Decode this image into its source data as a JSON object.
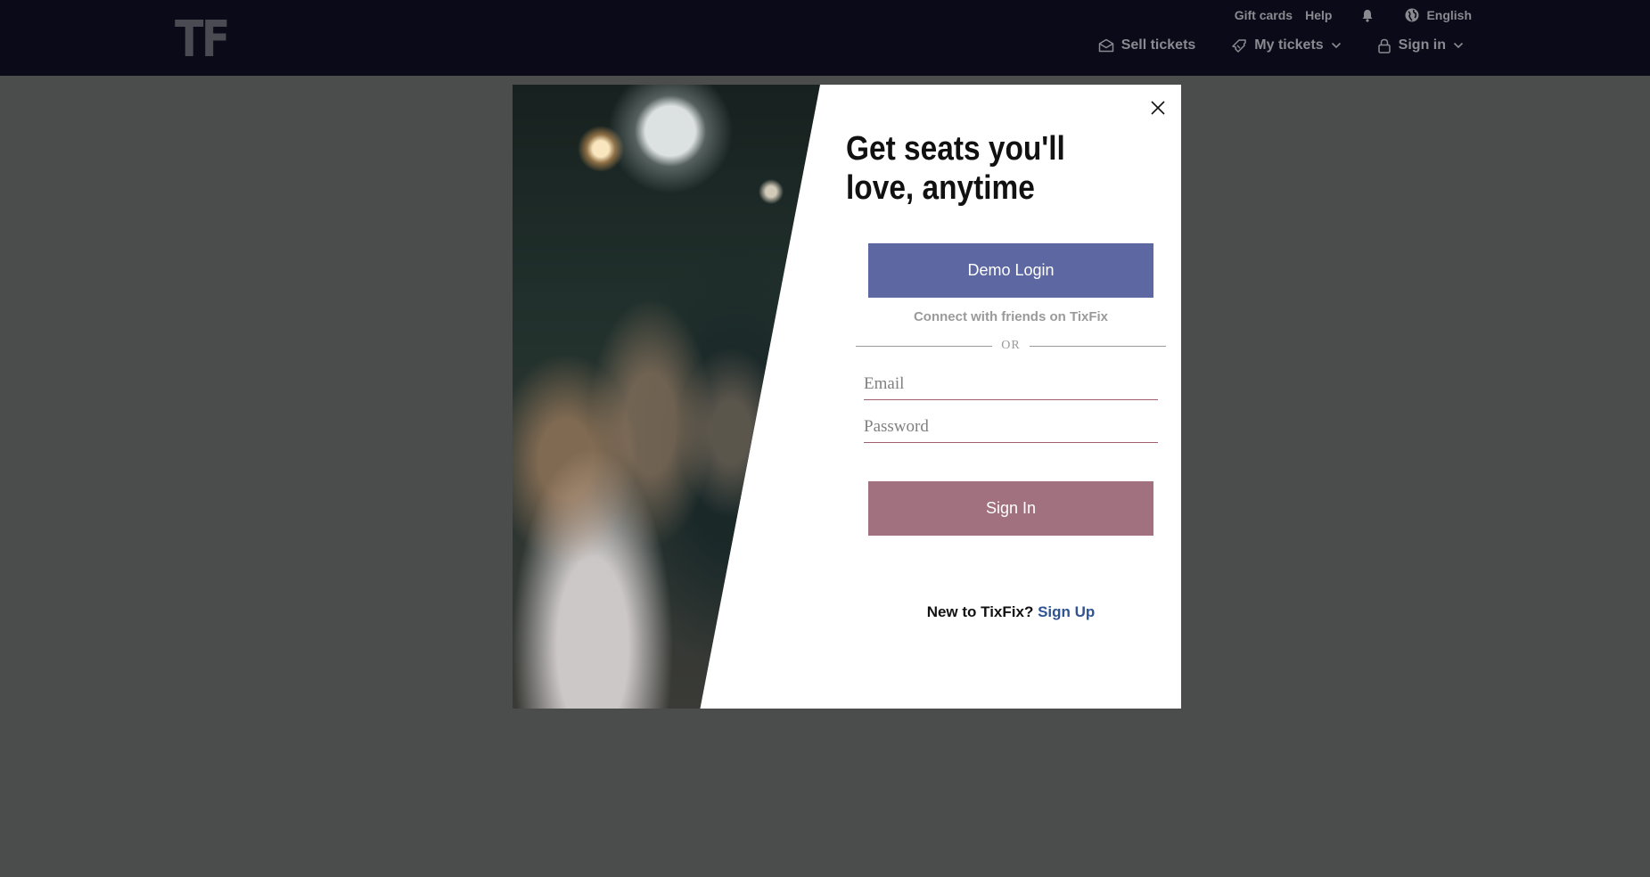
{
  "header": {
    "logo": "TF",
    "util": {
      "gift_cards": "Gift cards",
      "help": "Help",
      "language": "English"
    },
    "nav": {
      "sell_tickets": "Sell tickets",
      "my_tickets": "My tickets",
      "sign_in": "Sign in"
    }
  },
  "modal": {
    "title": "Get seats you'll love, anytime",
    "demo_login": "Demo Login",
    "connect_text": "Connect with friends on TixFix",
    "or_text": "OR",
    "email_placeholder": "Email",
    "password_placeholder": "Password",
    "sign_in_button": "Sign In",
    "new_to": "New to TixFix?",
    "sign_up": "Sign Up"
  },
  "colors": {
    "header_bg": "#0a0a19",
    "overlay_bg": "#4b4d4c",
    "demo_button": "#5d68a3",
    "sign_in_button": "#a1717f",
    "sign_up_link": "#2f5393"
  },
  "icons": [
    "bell-icon",
    "globe-icon",
    "envelope-icon",
    "ticket-icon",
    "chevron-down-icon",
    "lock-icon",
    "close-icon"
  ]
}
